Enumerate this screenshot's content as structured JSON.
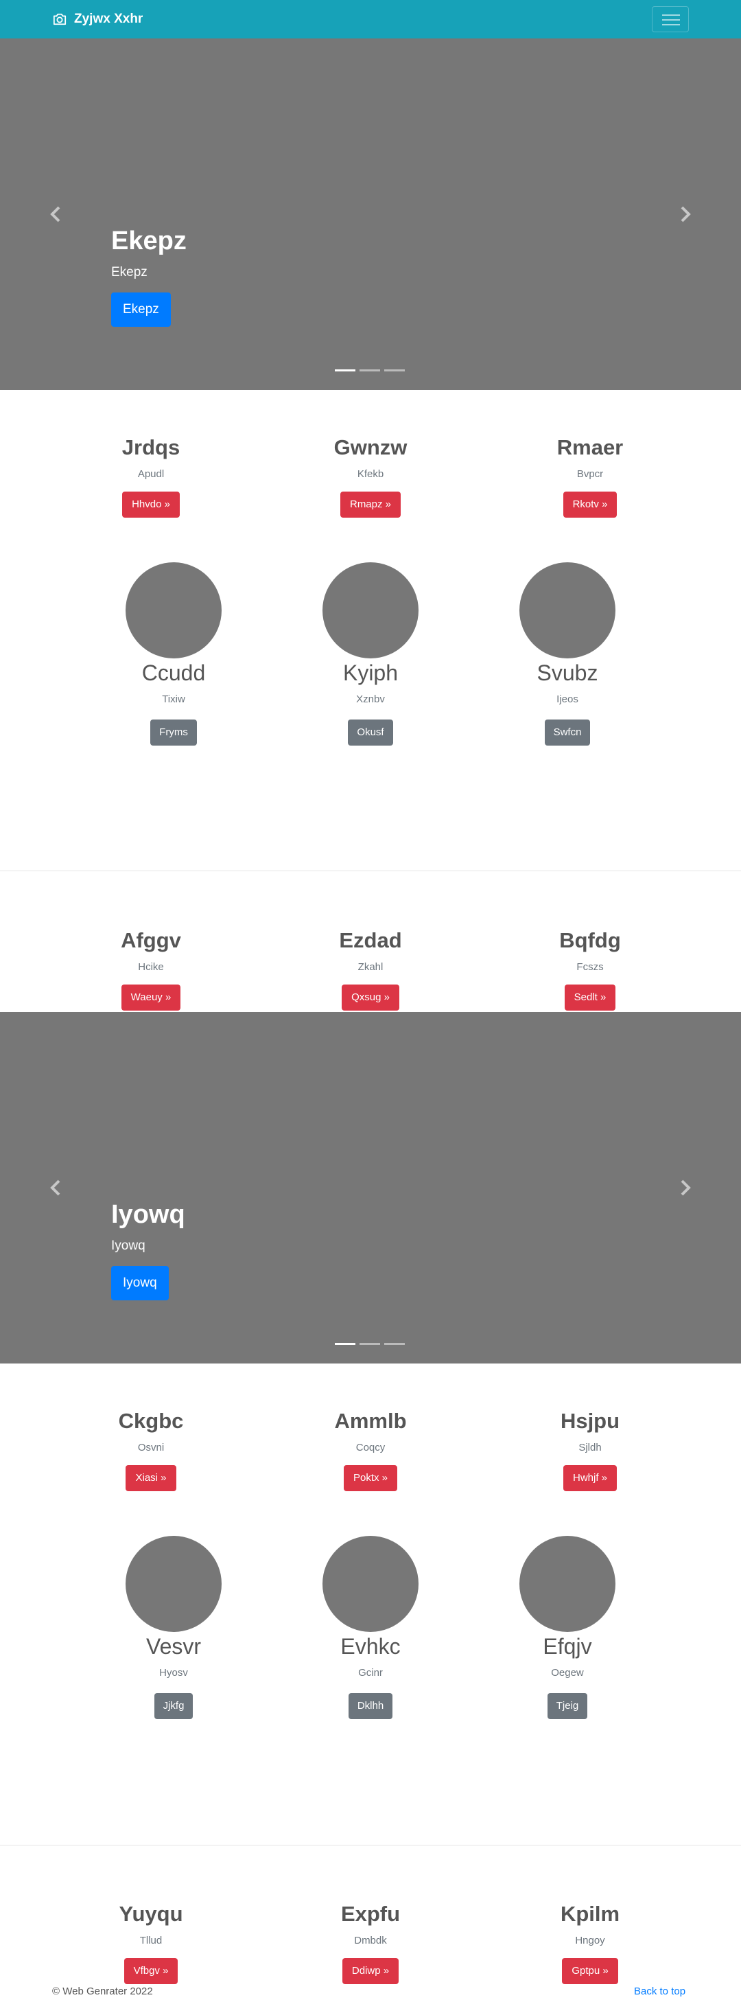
{
  "navbar": {
    "brand": "Zyjwx Xxhr"
  },
  "carousel1": {
    "title": "Ekepz",
    "subtitle": "Ekepz",
    "button": "Ekepz"
  },
  "row1": [
    {
      "title": "Jrdqs",
      "sub": "Apudl",
      "button": "Hhvdo »"
    },
    {
      "title": "Gwnzw",
      "sub": "Kfekb",
      "button": "Rmapz »"
    },
    {
      "title": "Rmaer",
      "sub": "Bvpcr",
      "button": "Rkotv »"
    }
  ],
  "circles1": [
    {
      "title": "Ccudd",
      "sub": "Tixiw",
      "button": "Fryms"
    },
    {
      "title": "Kyiph",
      "sub": "Xznbv",
      "button": "Okusf"
    },
    {
      "title": "Svubz",
      "sub": "Ijeos",
      "button": "Swfcn"
    }
  ],
  "row2": [
    {
      "title": "Afggv",
      "sub": "Hcike",
      "button": "Waeuy »"
    },
    {
      "title": "Ezdad",
      "sub": "Zkahl",
      "button": "Qxsug »"
    },
    {
      "title": "Bqfdg",
      "sub": "Fcszs",
      "button": "Sedlt »"
    }
  ],
  "carousel2": {
    "title": "Iyowq",
    "subtitle": "Iyowq",
    "button": "Iyowq"
  },
  "row3": [
    {
      "title": "Ckgbc",
      "sub": "Osvni",
      "button": "Xiasi »"
    },
    {
      "title": "Ammlb",
      "sub": "Coqcy",
      "button": "Poktx »"
    },
    {
      "title": "Hsjpu",
      "sub": "Sjldh",
      "button": "Hwhjf »"
    }
  ],
  "circles2": [
    {
      "title": "Vesvr",
      "sub": "Hyosv",
      "button": "Jjkfg"
    },
    {
      "title": "Evhkc",
      "sub": "Gcinr",
      "button": "Dklhh"
    },
    {
      "title": "Efqjv",
      "sub": "Oegew",
      "button": "Tjeig"
    }
  ],
  "row4": [
    {
      "title": "Yuyqu",
      "sub": "Tllud",
      "button": "Vfbgv »"
    },
    {
      "title": "Expfu",
      "sub": "Dmbdk",
      "button": "Ddiwp »"
    },
    {
      "title": "Kpilm",
      "sub": "Hngoy",
      "button": "Gptpu »"
    }
  ],
  "footer": {
    "copyright": "© Web Genrater 2022",
    "back_to_top": "Back to top"
  }
}
